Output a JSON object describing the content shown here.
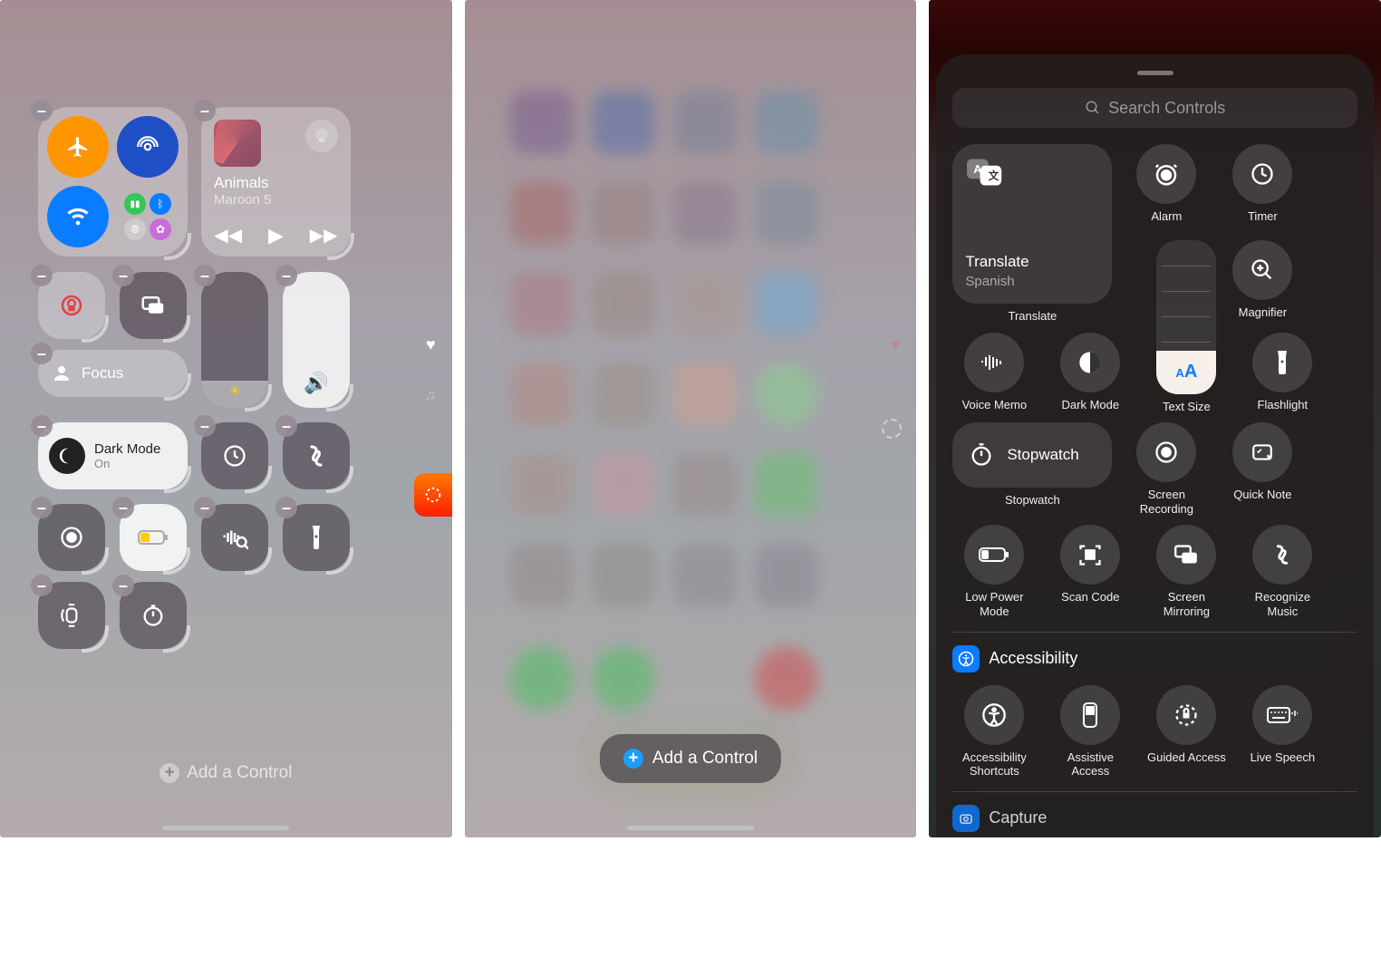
{
  "panel1": {
    "music": {
      "title": "Animals",
      "artist": "Maroon 5"
    },
    "focus_label": "Focus",
    "darkmode": {
      "title": "Dark Mode",
      "status": "On"
    },
    "add_control_label": "Add a Control"
  },
  "panel2": {
    "add_control_label": "Add a Control"
  },
  "panel3": {
    "search_placeholder": "Search Controls",
    "translate": {
      "title": "Translate",
      "subtitle": "Spanish",
      "label": "Translate"
    },
    "items": {
      "alarm": "Alarm",
      "timer": "Timer",
      "magnifier": "Magnifier",
      "voice_memo": "Voice Memo",
      "dark_mode": "Dark Mode",
      "text_size": "Text Size",
      "flashlight": "Flashlight",
      "stopwatch": "Stopwatch",
      "stopwatch_label": "Stopwatch",
      "screen_recording": "Screen Recording",
      "quick_note": "Quick Note",
      "low_power": "Low Power Mode",
      "scan_code": "Scan Code",
      "screen_mirroring": "Screen Mirroring",
      "recognize_music": "Recognize Music"
    },
    "accessibility_header": "Accessibility",
    "accessibility_items": {
      "shortcuts": "Accessibility Shortcuts",
      "assistive": "Assistive Access",
      "guided": "Guided Access",
      "live_speech": "Live Speech"
    },
    "capture_header": "Capture"
  }
}
